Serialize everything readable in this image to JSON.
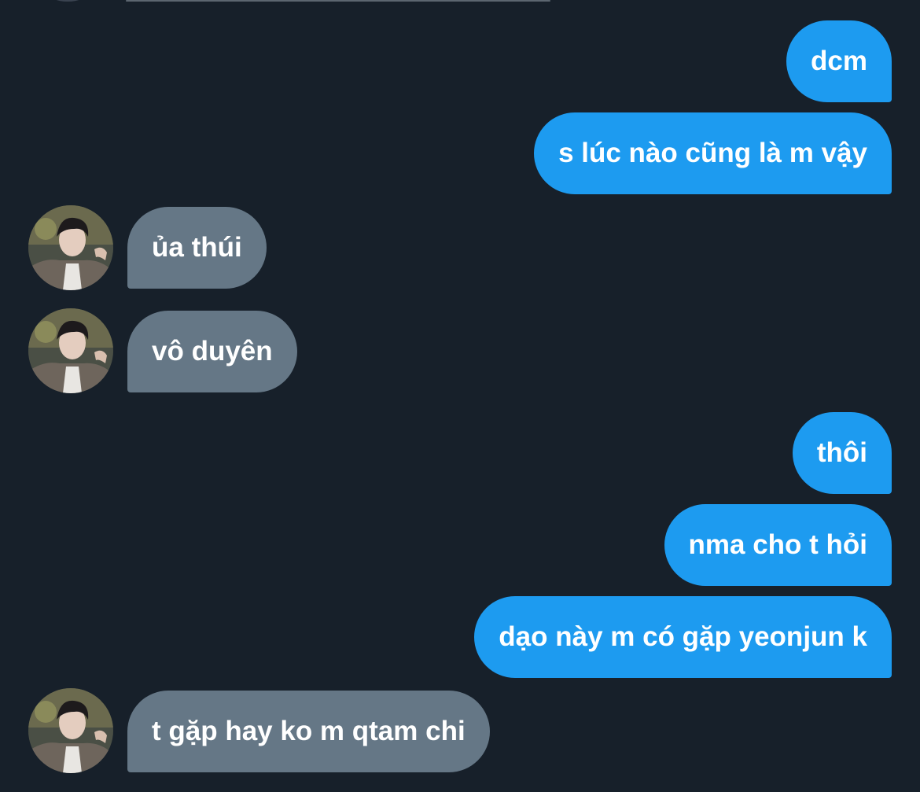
{
  "conversation": {
    "messages": [
      {
        "direction": "sent",
        "text": "dcm"
      },
      {
        "direction": "sent",
        "text": "s lúc nào cũng là m vậy"
      },
      {
        "direction": "received",
        "text": "ủa thúi"
      },
      {
        "direction": "received",
        "text": "vô duyên"
      },
      {
        "direction": "sent",
        "text": "thôi"
      },
      {
        "direction": "sent",
        "text": "nma cho t hỏi"
      },
      {
        "direction": "sent",
        "text": "dạo này m có gặp yeonjun k"
      },
      {
        "direction": "received",
        "text": "t gặp hay ko m qtam chi"
      }
    ]
  },
  "colors": {
    "background": "#17202a",
    "sent_bubble": "#1d9bf0",
    "received_bubble": "#657786",
    "bubble_text": "#ffffff"
  },
  "icons": {
    "avatar": "contact-avatar-photo"
  }
}
